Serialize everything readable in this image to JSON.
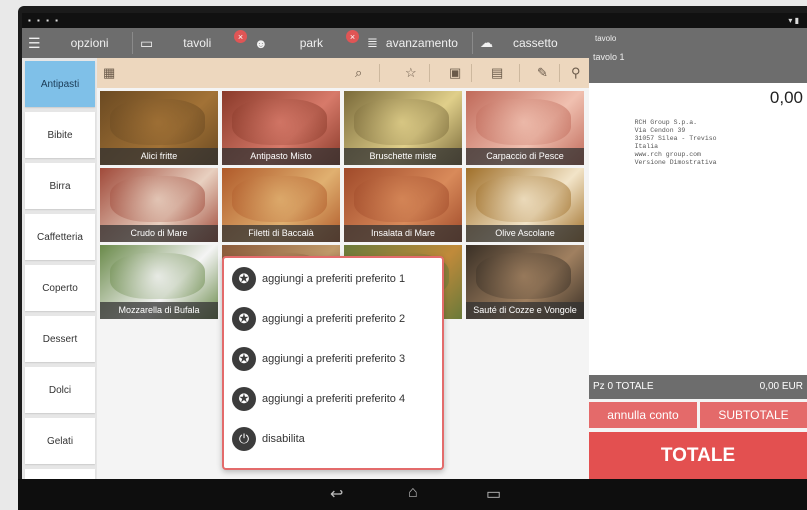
{
  "status_bar": {
    "left": "",
    "right": ""
  },
  "top_bar": {
    "items": [
      {
        "label": "opzioni",
        "icon": "menu-icon"
      },
      {
        "label": "tavoli",
        "icon": "table-icon",
        "badge": "×"
      },
      {
        "label": "park",
        "icon": "person-icon",
        "badge": "×"
      },
      {
        "label": "avanzamento",
        "icon": "progress-icon"
      },
      {
        "label": "cassetto",
        "icon": "drawer-icon"
      }
    ]
  },
  "right_panel": {
    "header_left": "tavolo",
    "header_right": "",
    "subheader": "tavolo 1",
    "amount": "0,00",
    "receipt_lines": [
      "RCH Group S.p.a.",
      "Via Cendon 39",
      "31057 Silea - Treviso",
      "Italia",
      "www.rch group.com",
      "Versione Dimostrativa"
    ],
    "total_label": "TOTALE",
    "total_prefix": "Pz 0",
    "total_value": "0,00 EUR",
    "btn_annulla": "annulla conto",
    "btn_subtotale": "SUBTOTALE",
    "btn_totale": "TOTALE"
  },
  "categories": [
    "Antipasti",
    "Bibite",
    "Birra",
    "Caffetteria",
    "Coperto",
    "Dessert",
    "Dolci",
    "Gelati"
  ],
  "active_category": "Antipasti",
  "tiles": [
    {
      "label": "Alici fritte",
      "colors": [
        "#6b4a22",
        "#a27236"
      ]
    },
    {
      "label": "Antipasto Misto",
      "colors": [
        "#8a3a2a",
        "#d77a6a"
      ]
    },
    {
      "label": "Bruschette miste",
      "colors": [
        "#7a6a3a",
        "#e0cf8a"
      ]
    },
    {
      "label": "Carpaccio di Pesce",
      "colors": [
        "#c06a5a",
        "#f0c0b0"
      ]
    },
    {
      "label": "Crudo di Mare",
      "colors": [
        "#a04a3a",
        "#e8d0c0"
      ]
    },
    {
      "label": "Filetti di Baccalà",
      "colors": [
        "#b05a2a",
        "#e0b070"
      ]
    },
    {
      "label": "Insalata di Mare",
      "colors": [
        "#a04a2a",
        "#d88a5a"
      ]
    },
    {
      "label": "Olive Ascolane",
      "colors": [
        "#a0702a",
        "#f2e4c8"
      ]
    },
    {
      "label": "Mozzarella di Bufala",
      "colors": [
        "#6a8a4a",
        "#f4f4f4"
      ]
    },
    {
      "label": "",
      "colors": [
        "#8a5a3a",
        "#c09a6a"
      ]
    },
    {
      "label": "",
      "colors": [
        "#6a7a3a",
        "#c08a3a"
      ]
    },
    {
      "label": "Sauté di Cozze e Vongole",
      "colors": [
        "#3a3026",
        "#a08060"
      ]
    }
  ],
  "popup": {
    "options": [
      {
        "label": "aggiungi a preferiti preferito 1",
        "icon": "star-icon"
      },
      {
        "label": "aggiungi a preferiti preferito 2",
        "icon": "star-icon"
      },
      {
        "label": "aggiungi a preferiti preferito 3",
        "icon": "star-icon"
      },
      {
        "label": "aggiungi a preferiti preferito 4",
        "icon": "star-icon"
      },
      {
        "label": "disabilita",
        "icon": "power-icon"
      }
    ]
  }
}
